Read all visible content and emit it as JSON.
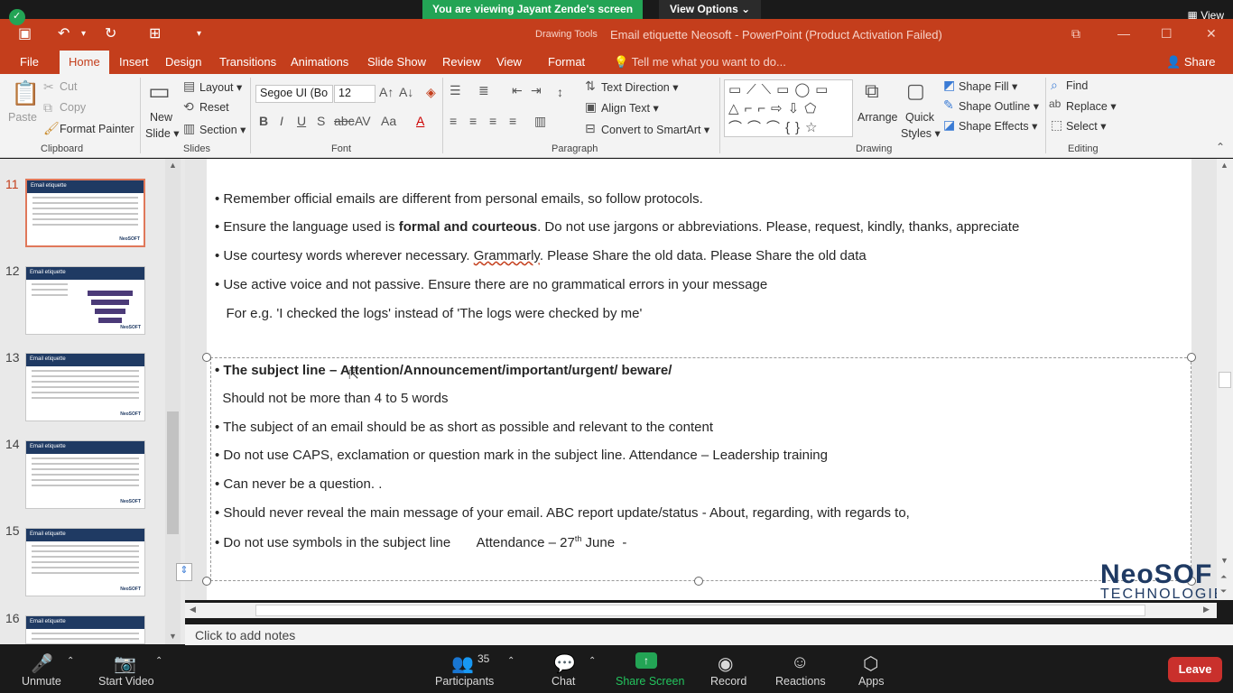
{
  "zoom": {
    "viewing_banner": "You are viewing Jayant Zende's screen",
    "view_options": "View Options ⌄",
    "view": "View",
    "bottom": {
      "unmute": "Unmute",
      "start_video": "Start Video",
      "participants": "Participants",
      "participants_count": "35",
      "chat": "Chat",
      "share_screen": "Share Screen",
      "record": "Record",
      "reactions": "Reactions",
      "apps": "Apps",
      "leave": "Leave"
    }
  },
  "window": {
    "drawing_tools": "Drawing Tools",
    "title": "Email etiquette Neosoft - PowerPoint (Product Activation Failed)"
  },
  "tabs": [
    "File",
    "Home",
    "Insert",
    "Design",
    "Transitions",
    "Animations",
    "Slide Show",
    "Review",
    "View",
    "Format"
  ],
  "tell_me": "Tell me what you want to do...",
  "share": "Share",
  "ribbon": {
    "clipboard": {
      "label": "Clipboard",
      "paste": "Paste",
      "cut": "Cut",
      "copy": "Copy",
      "format_painter": "Format Painter"
    },
    "slides": {
      "label": "Slides",
      "new_slide_1": "New",
      "new_slide_2": "Slide ▾",
      "layout": "Layout ▾",
      "reset": "Reset",
      "section": "Section ▾"
    },
    "font": {
      "label": "Font",
      "font_name": "Segoe UI (Bo",
      "font_size": "12"
    },
    "paragraph": {
      "label": "Paragraph",
      "text_direction": "Text Direction ▾",
      "align_text": "Align Text ▾",
      "convert_smartart": "Convert to SmartArt ▾"
    },
    "drawing": {
      "label": "Drawing",
      "arrange": "Arrange",
      "quick_styles_1": "Quick",
      "quick_styles_2": "Styles ▾",
      "shape_fill": "Shape Fill ▾",
      "shape_outline": "Shape Outline ▾",
      "shape_effects": "Shape Effects ▾"
    },
    "editing": {
      "label": "Editing",
      "find": "Find",
      "replace": "Replace ▾",
      "select": "Select ▾"
    }
  },
  "thumbnails": [
    {
      "num": "11",
      "title": "Email etiquette"
    },
    {
      "num": "12",
      "title": "Email etiquette"
    },
    {
      "num": "13",
      "title": "Email etiquette"
    },
    {
      "num": "14",
      "title": "Email etiquette"
    },
    {
      "num": "15",
      "title": "Email etiquette"
    },
    {
      "num": "16",
      "title": "Email etiquette"
    }
  ],
  "slide": {
    "lines": [
      {
        "pre": "•  Remember official emails are different from personal emails, so follow protocols.",
        "bold": "",
        "post": ""
      },
      {
        "pre": "•  Ensure the language used is ",
        "bold": "formal and courteous",
        "post": ". Do not use jargons or abbreviations.  Please, request, kindly, thanks, appreciate"
      },
      {
        "pre": "•  Use courtesy words wherever necessary.  ",
        "squiggle": "Grammarly",
        "post": ". Please Share the old data.  Please  Share the old data"
      },
      {
        "pre": "•  Use active voice and not passive. Ensure there are no grammatical errors in your message",
        "bold": "",
        "post": ""
      },
      {
        "pre": "   For e.g. 'I checked the logs' instead of 'The logs were checked by me'",
        "bold": "",
        "post": ""
      }
    ],
    "subject_line": "• The subject line – Attention/Announcement/important/urgent/ beware/",
    "items": [
      "  Should not be more than 4 to 5 words",
      "• The subject of an email should be as short as possible and relevant to the content",
      "• Do  not use CAPS, exclamation or question mark in the subject line.   Attendance – Leadership training",
      "• Can never be a question. .",
      "• Should never reveal the main message of your email.  ABC report update/status -  About, regarding, with regards to,"
    ],
    "last_item_pre": "• Do not use symbols in the subject line       Attendance – 27",
    "last_item_sup": "th",
    "last_item_post": " June  -",
    "logo_main": "NeoSOF",
    "logo_sub": "TECHNOLOGIE"
  },
  "notes": "Click to add notes",
  "colors": {
    "ppt_accent": "#c43e1c",
    "zoom_green": "#23a455",
    "leave_red": "#c9302c",
    "slide_header": "#1f3a63"
  }
}
